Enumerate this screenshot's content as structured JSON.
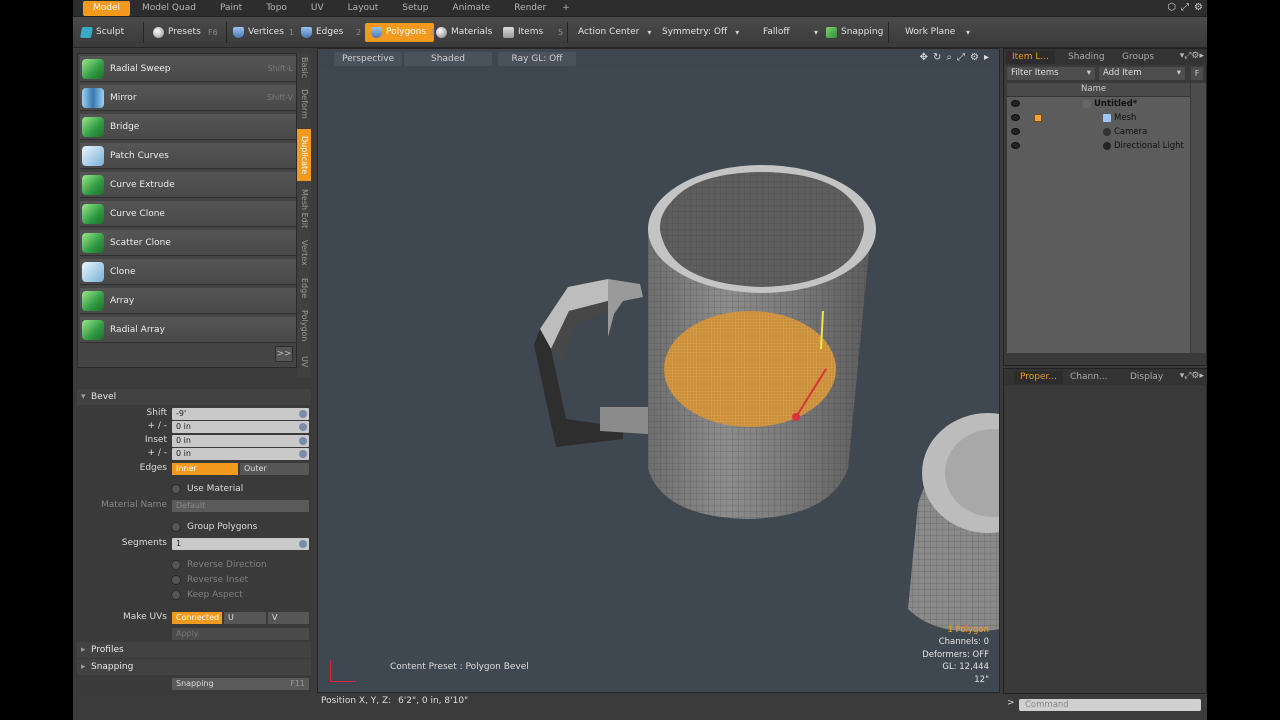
{
  "layout_tabs": [
    "Model",
    "Model Quad",
    "Paint",
    "Topo",
    "UV",
    "Layout",
    "Setup",
    "Animate",
    "Render",
    "+"
  ],
  "toolbar": {
    "sculpt": "Sculpt",
    "presets": "Presets",
    "presets_key": "F6",
    "vertices": "Vertices",
    "vertices_num": "1",
    "edges": "Edges",
    "edges_num": "2",
    "polygons": "Polygons",
    "polygons_num": "3",
    "materials": "Materials",
    "items": "Items",
    "items_num": "5",
    "action_center": "Action Center",
    "symmetry": "Symmetry: Off",
    "falloff": "Falloff",
    "snapping": "Snapping",
    "work_plane": "Work Plane"
  },
  "tools": [
    {
      "label": "Radial Sweep",
      "shortcut": "Shift-L"
    },
    {
      "label": "Mirror",
      "shortcut": "Shift-V"
    },
    {
      "label": "Bridge",
      "shortcut": ""
    },
    {
      "label": "Patch Curves",
      "shortcut": ""
    },
    {
      "label": "Curve Extrude",
      "shortcut": ""
    },
    {
      "label": "Curve Clone",
      "shortcut": ""
    },
    {
      "label": "Scatter Clone",
      "shortcut": ""
    },
    {
      "label": "Clone",
      "shortcut": ""
    },
    {
      "label": "Array",
      "shortcut": ""
    },
    {
      "label": "Radial Array",
      "shortcut": ""
    }
  ],
  "tools_more": ">>",
  "vtabs": [
    "Basic",
    "Deform",
    "Duplicate",
    "Mesh Edit",
    "Vertex",
    "Edge",
    "Polygon",
    "UV"
  ],
  "bevel": {
    "title": "Bevel",
    "shift_label": "Shift",
    "shift_value": "-9'",
    "shift_pm_label": "+ / -",
    "shift_pm_value": "0 in",
    "inset_label": "Inset",
    "inset_value": "0 in",
    "inset_pm_label": "+ / -",
    "inset_pm_value": "0 in",
    "edges_label": "Edges",
    "edges_inner": "Inner",
    "edges_outer": "Outer",
    "use_material": "Use Material",
    "material_name_label": "Material Name",
    "material_name_value": "Default",
    "group_polygons": "Group Polygons",
    "segments_label": "Segments",
    "segments_value": "1",
    "reverse_direction": "Reverse Direction",
    "reverse_inset": "Reverse Inset",
    "keep_aspect": "Keep Aspect",
    "make_uvs_label": "Make UVs",
    "make_uvs_connected": "Connected",
    "make_uvs_u": "U",
    "make_uvs_v": "V",
    "apply": "Apply",
    "profiles": "Profiles",
    "snapping": "Snapping",
    "snapping_value": "Snapping",
    "snapping_key": "F11"
  },
  "viewport": {
    "view": "Perspective",
    "shading": "Shaded",
    "raygl": "Ray GL: Off",
    "content_preset": "Content Preset : Polygon Bevel",
    "info": {
      "polygons": "1 Polygon",
      "channels": "Channels: 0",
      "deformers": "Deformers: OFF",
      "gl": "GL: 12,444",
      "grid": "12\""
    }
  },
  "status": {
    "position_label": "Position X, Y, Z:",
    "position_value": "6'2\", 0 in, 8'10\""
  },
  "item_list": {
    "tabs": [
      "Item L...",
      "Shading",
      "Groups"
    ],
    "filter": "Filter Items",
    "add_item": "Add Item",
    "add_key": "F",
    "col_name": "Name",
    "items": [
      {
        "label": "Untitled*",
        "icon": "scene-icon",
        "level": 0
      },
      {
        "label": "Mesh",
        "icon": "mesh-icon",
        "level": 1
      },
      {
        "label": "Camera",
        "icon": "camera-icon",
        "level": 1
      },
      {
        "label": "Directional Light",
        "icon": "light-icon",
        "level": 1
      }
    ]
  },
  "properties": {
    "tabs": [
      "Proper...",
      "Chann...",
      "Display"
    ]
  },
  "command": {
    "placeholder": "Command"
  },
  "colors": {
    "accent": "#f39a1e",
    "viewport_bg": "#3f4850",
    "panel_bg": "#3a3a3a"
  }
}
